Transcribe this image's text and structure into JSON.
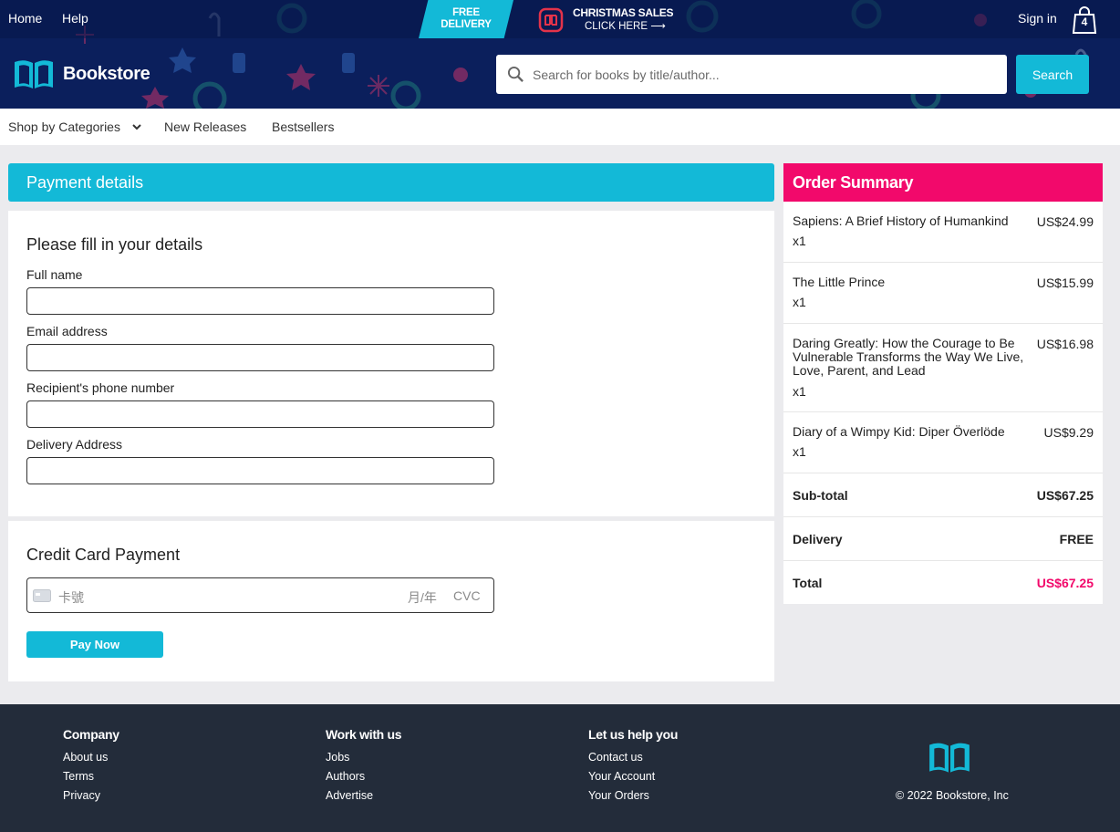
{
  "header": {
    "links": {
      "home": "Home",
      "help": "Help"
    },
    "promo": {
      "free_delivery_line1": "FREE",
      "free_delivery_line2": "DELIVERY",
      "sale_line1": "CHRISTMAS SALES",
      "sale_line2": "CLICK HERE ⟶"
    },
    "sign_in": "Sign in",
    "cart_count": "4",
    "logo_text": "Bookstore",
    "search": {
      "placeholder": "Search for books by title/author...",
      "button": "Search"
    }
  },
  "subnav": {
    "items": [
      {
        "label": "Shop by Categories"
      },
      {
        "label": "New Releases"
      },
      {
        "label": "Bestsellers"
      }
    ]
  },
  "payment": {
    "header": "Payment details",
    "details_title": "Please fill in your details",
    "fields": [
      {
        "label": "Full name",
        "value": ""
      },
      {
        "label": "Email address",
        "value": ""
      },
      {
        "label": "Recipient's phone number",
        "value": ""
      },
      {
        "label": "Delivery Address",
        "value": ""
      }
    ],
    "card_title": "Credit Card Payment",
    "card_number_placeholder": "卡號",
    "card_expiry_placeholder": "月/年",
    "card_cvc_placeholder": "CVC",
    "pay_button": "Pay Now"
  },
  "summary": {
    "title": "Order Summary",
    "items": [
      {
        "title": "Sapiens: A Brief History of Humankind",
        "price": "US$24.99",
        "qty": "x1"
      },
      {
        "title": "The Little Prince",
        "price": "US$15.99",
        "qty": "x1"
      },
      {
        "title": "Daring Greatly: How the Courage to Be Vulnerable Transforms the Way We Live, Love, Parent, and Lead",
        "price": "US$16.98",
        "qty": "x1"
      },
      {
        "title": "Diary of a Wimpy Kid: Diper Överlöde",
        "price": "US$9.29",
        "qty": "x1"
      }
    ],
    "subtotal": {
      "label": "Sub-total",
      "value": "US$67.25"
    },
    "delivery": {
      "label": "Delivery",
      "value": "FREE"
    },
    "total": {
      "label": "Total",
      "value": "US$67.25"
    }
  },
  "footer": {
    "columns": [
      {
        "heading": "Company",
        "links": [
          "About us",
          "Terms",
          "Privacy"
        ]
      },
      {
        "heading": "Work with us",
        "links": [
          "Jobs",
          "Authors",
          "Advertise"
        ]
      },
      {
        "heading": "Let us help you",
        "links": [
          "Contact us",
          "Your Account",
          "Your Orders"
        ]
      }
    ],
    "copyright": "© 2022 Bookstore, Inc"
  },
  "colors": {
    "accent": "#13b9d7",
    "summary": "#f2096b",
    "banner": "#0b1f5c",
    "footer": "#232c3a"
  },
  "icons": [
    "book-logo-icon",
    "search-icon",
    "cart-bag-icon",
    "chevron-down-icon",
    "credit-card-icon",
    "book-badge-icon"
  ]
}
